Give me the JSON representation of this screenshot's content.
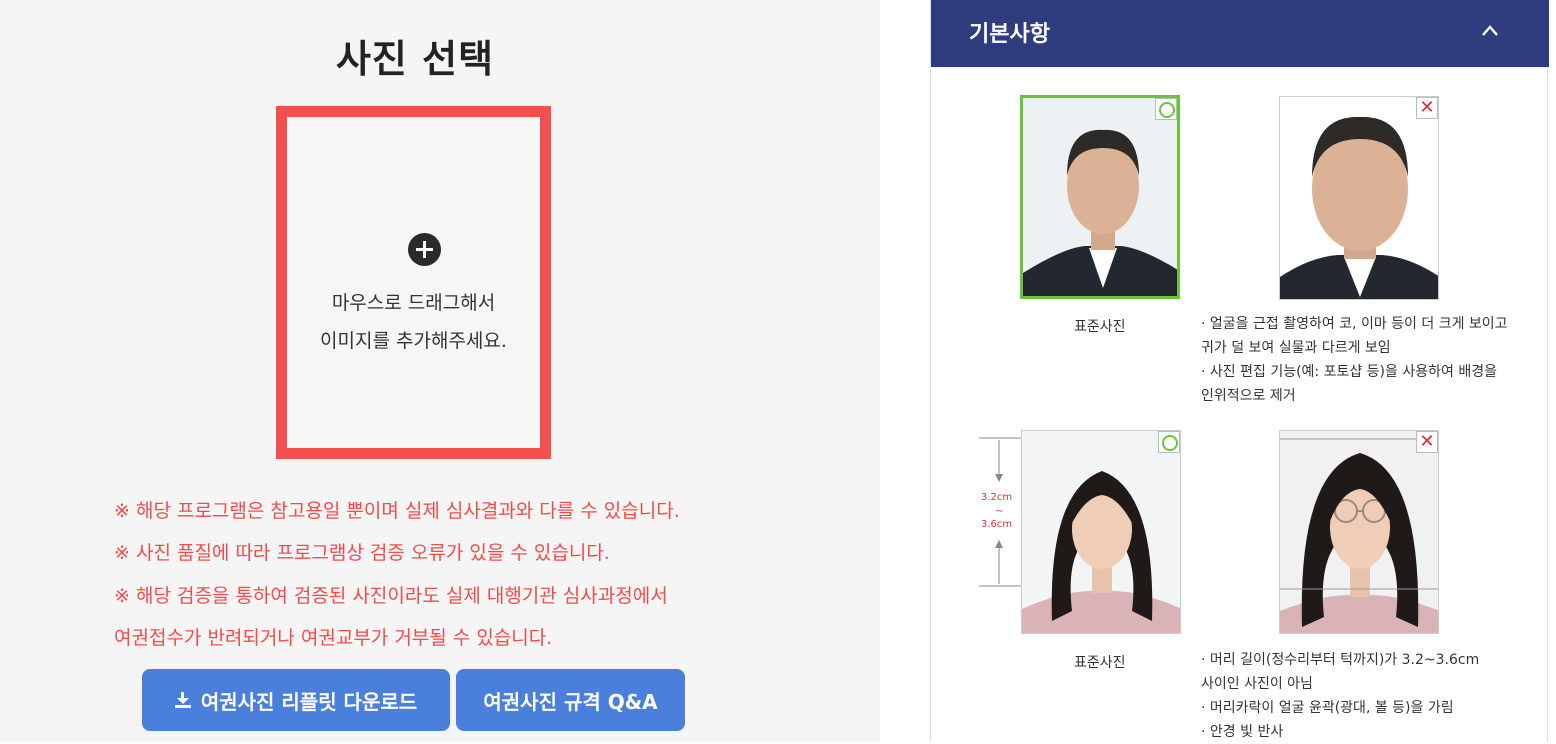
{
  "left": {
    "title": "사진 선택",
    "dropzone": {
      "line1": "마우스로 드래그해서",
      "line2": "이미지를 추가해주세요."
    },
    "notices": [
      "※ 해당 프로그램은 참고용일 뿐이며 실제 심사결과와 다를 수 있습니다.",
      "※ 사진 품질에 따라 프로그램상 검증 오류가 있을 수 있습니다.",
      "※ 해당 검증을 통하여 검증된 사진이라도 실제 대행기관 심사과정에서",
      "여권접수가 반려되거나 여권교부가 거부될 수 있습니다."
    ],
    "buttons": {
      "download": "여권사진 리플릿 다운로드",
      "qa": "여권사진 규격 Q&A"
    },
    "accent_color": "#f24f4f",
    "button_color": "#4b7fdc"
  },
  "panel": {
    "title": "기본사항",
    "header_color": "#2f3c7e",
    "row1": {
      "good_caption": "표준사진",
      "bad_notes": [
        "· 얼굴을 근접 촬영하여 코, 이마 등이 더 크게 보이고",
        "  귀가 덜 보여 실물과 다르게 보임",
        "· 사진 편집 기능(예: 포토샵 등)을 사용하여 배경을",
        "  인위적으로 제거"
      ]
    },
    "row2": {
      "good_caption": "표준사진",
      "measure_top": "3.2cm",
      "measure_mid": "~",
      "measure_bottom": "3.6cm",
      "bad_notes": [
        "· 머리 길이(정수리부터 턱까지)가 3.2~3.6cm",
        "  사이인 사진이 아님",
        "· 머리카락이 얼굴 윤곽(광대, 볼 등)을 가림",
        "· 안경 빛 반사"
      ]
    },
    "good_mark": "circle-mark",
    "bad_mark": "✕"
  }
}
